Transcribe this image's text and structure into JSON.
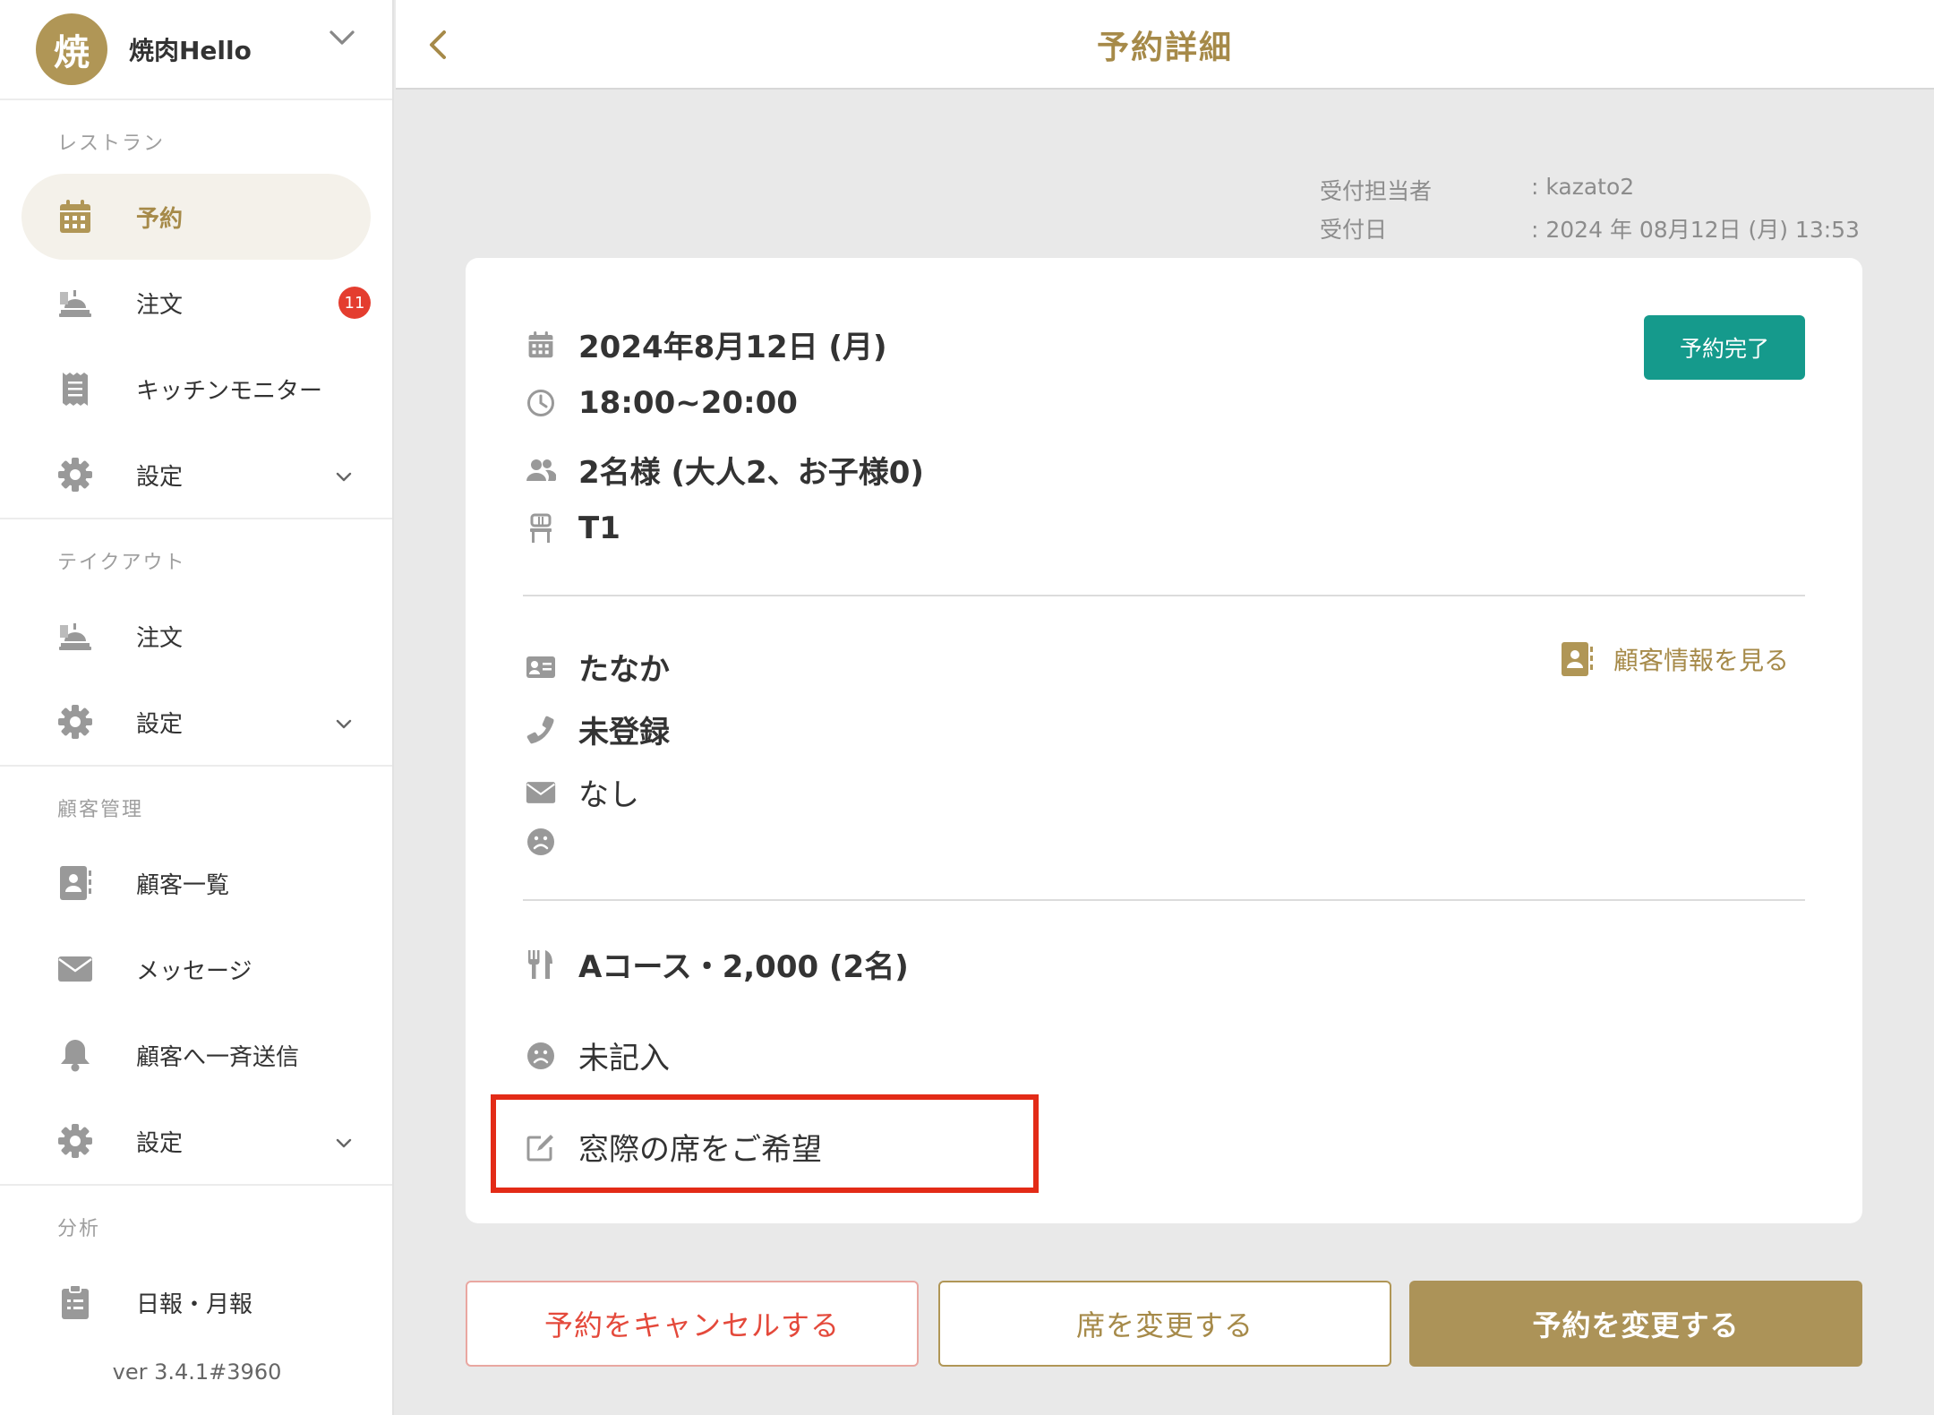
{
  "colors": {
    "brand_gold": "#a68a49",
    "status_teal": "#159a8c",
    "badge_red": "#e43d2f",
    "highlight_red": "#e32b17"
  },
  "store": {
    "logo_text": "焼",
    "name": "焼肉Hello"
  },
  "sidebar": {
    "sections": [
      {
        "title": "レストラン",
        "items": [
          {
            "icon": "calendar-icon",
            "label": "予約",
            "active": true
          },
          {
            "icon": "tray-icon",
            "label": "注文",
            "badge": "11"
          },
          {
            "icon": "receipt-icon",
            "label": "キッチンモニター"
          },
          {
            "icon": "gear-icon",
            "label": "設定",
            "expandable": true
          }
        ]
      },
      {
        "title": "テイクアウト",
        "items": [
          {
            "icon": "tray-icon",
            "label": "注文"
          },
          {
            "icon": "gear-icon",
            "label": "設定",
            "expandable": true
          }
        ]
      },
      {
        "title": "顧客管理",
        "items": [
          {
            "icon": "contact-book-icon",
            "label": "顧客一覧"
          },
          {
            "icon": "envelope-icon",
            "label": "メッセージ"
          },
          {
            "icon": "bell-icon",
            "label": "顧客へ一斉送信"
          },
          {
            "icon": "gear-icon",
            "label": "設定",
            "expandable": true
          }
        ]
      },
      {
        "title": "分析",
        "items": [
          {
            "icon": "clipboard-icon",
            "label": "日報・月報"
          }
        ]
      }
    ],
    "version": "ver 3.4.1#3960"
  },
  "header": {
    "title": "予約詳細"
  },
  "meta": {
    "staff_label": "受付担当者",
    "staff_value": ": kazato2",
    "date_label": "受付日",
    "date_value": ": 2024 年 08月12日 (月) 13:53"
  },
  "reservation": {
    "date": "2024年8月12日 (月)",
    "time": "18:00~20:00",
    "guests": "2名様 (大人2、お子様0)",
    "table": "T1",
    "status": "予約完了"
  },
  "customer": {
    "name": "たなか",
    "phone": "未登録",
    "email": "なし",
    "view_link": "顧客情報を見る"
  },
  "details": {
    "course": "Aコース・2,000 (2名)",
    "allergy": "未記入",
    "note": "窓際の席をご希望"
  },
  "actions": {
    "cancel": "予約をキャンセルする",
    "change_seat": "席を変更する",
    "change_reservation": "予約を変更する"
  }
}
